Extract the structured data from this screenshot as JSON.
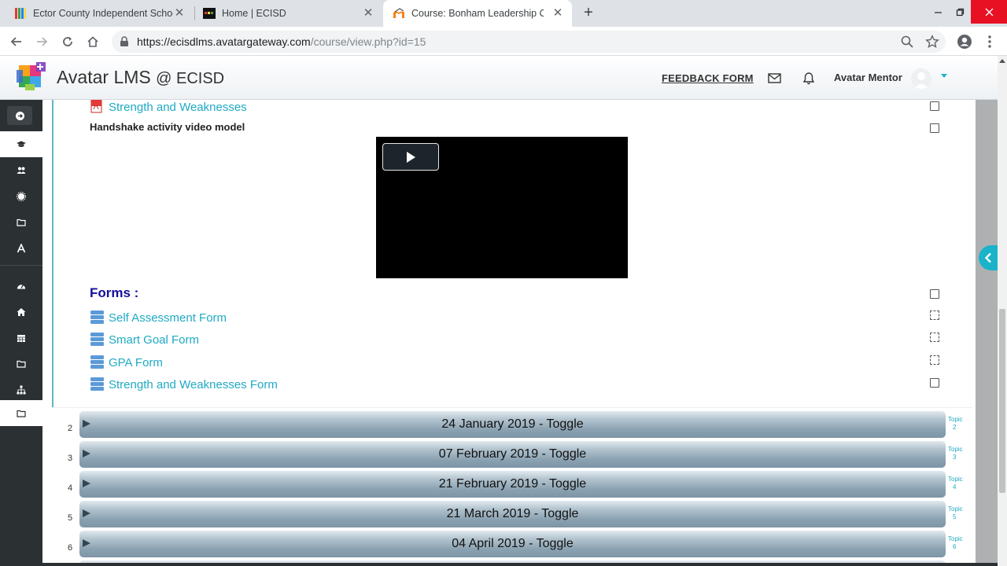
{
  "browser": {
    "tabs": [
      {
        "title": "Ector County Independent Schoo",
        "active": false
      },
      {
        "title": "Home | ECISD",
        "active": false
      },
      {
        "title": "Course: Bonham Leadership Coa",
        "active": true
      }
    ],
    "new_tab_label": "+",
    "url_host": "https://ecisdlms.avatargateway.com",
    "url_path": "/course/view.php?id=15"
  },
  "header": {
    "site_title": "Avatar LMS",
    "site_suffix": "@ ECISD",
    "feedback_label": "FEEDBACK FORM",
    "user_name": "Avatar Mentor"
  },
  "content": {
    "top_activity": "Strength and Weaknesses",
    "video_label": "Handshake activity video model",
    "forms_heading": "Forms :",
    "forms": [
      {
        "label": "Self Assessment Form",
        "completion": "auto"
      },
      {
        "label": "Smart Goal Form",
        "completion": "auto"
      },
      {
        "label": "GPA Form",
        "completion": "auto"
      },
      {
        "label": "Strength and Weaknesses Form",
        "completion": "manual"
      }
    ]
  },
  "topics": [
    {
      "num": "2",
      "title": "24 January 2019 - Toggle",
      "side_label": "Topic",
      "side_num": "2"
    },
    {
      "num": "3",
      "title": "07 February 2019 - Toggle",
      "side_label": "Topic",
      "side_num": "3"
    },
    {
      "num": "4",
      "title": "21 February 2019 - Toggle",
      "side_label": "Topic",
      "side_num": "4"
    },
    {
      "num": "5",
      "title": "21 March 2019 - Toggle",
      "side_label": "Topic",
      "side_num": "5"
    },
    {
      "num": "6",
      "title": "04 April 2019 - Toggle",
      "side_label": "Topic",
      "side_num": "6"
    }
  ],
  "colors": {
    "link": "#1faac4",
    "heading": "#140f9c",
    "sidebar": "#2b3033",
    "accent": "#1ab3c9"
  }
}
